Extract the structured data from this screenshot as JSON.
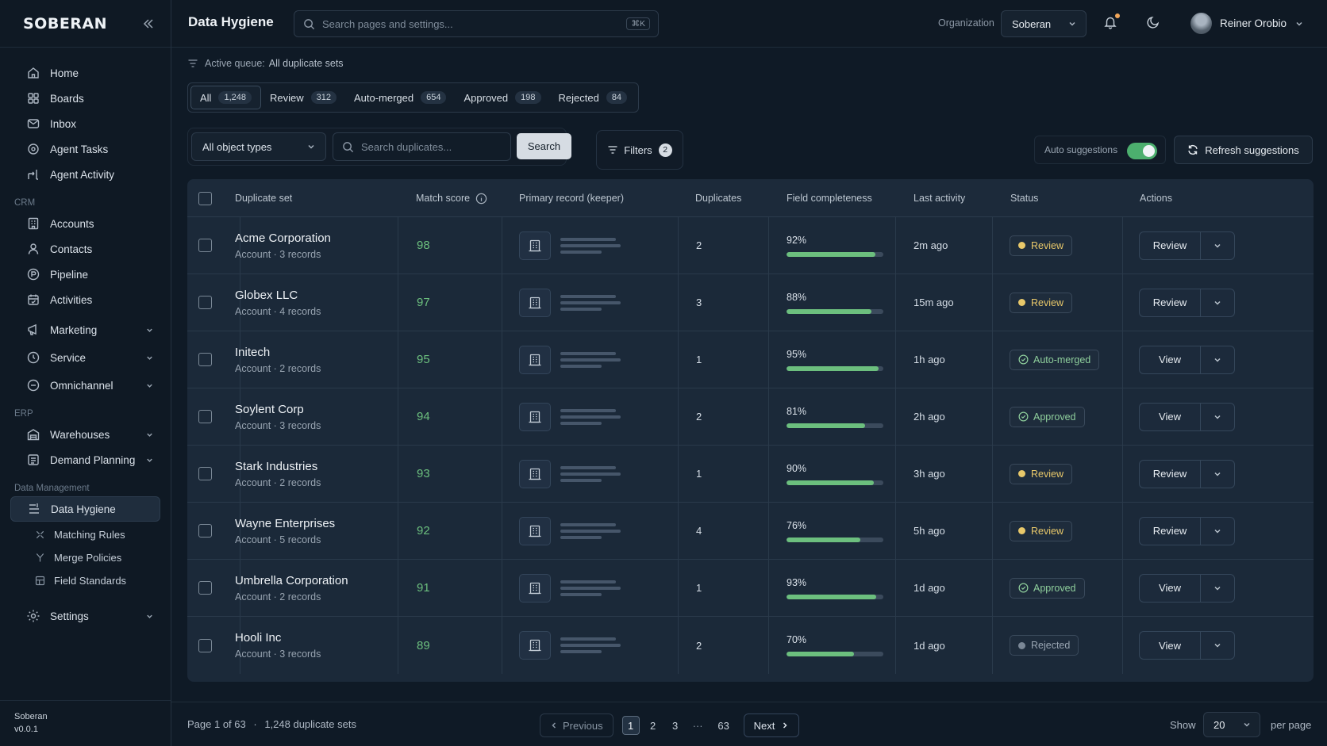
{
  "app": {
    "logo": "SOBERAN",
    "version_name": "Soberan",
    "version": "v0.0.1"
  },
  "header": {
    "title": "Data Hygiene",
    "search_placeholder": "Search pages and settings...",
    "shortcut": "⌘K",
    "org_label": "Organization",
    "org_value": "Soberan",
    "user_name": "Reiner Orobio"
  },
  "sidebar": {
    "items": [
      {
        "label": "Home",
        "icon": "home-icon"
      },
      {
        "label": "Boards",
        "icon": "boards-icon"
      },
      {
        "label": "Inbox",
        "icon": "inbox-icon"
      },
      {
        "label": "Agent Tasks",
        "icon": "agent-tasks-icon"
      },
      {
        "label": "Agent Activity",
        "icon": "agent-activity-icon"
      }
    ],
    "crm_label": "CRM",
    "crm_items": [
      {
        "label": "Accounts",
        "icon": "accounts-icon"
      },
      {
        "label": "Contacts",
        "icon": "contacts-icon"
      },
      {
        "label": "Pipeline",
        "icon": "pipeline-icon"
      },
      {
        "label": "Activities",
        "icon": "activities-icon"
      }
    ],
    "groups": [
      {
        "label": "Marketing",
        "icon": "marketing-icon"
      },
      {
        "label": "Service",
        "icon": "service-icon"
      },
      {
        "label": "Omnichannel",
        "icon": "omnichannel-icon"
      }
    ],
    "erp_label": "ERP",
    "erp_items": [
      {
        "label": "Warehouses",
        "icon": "warehouses-icon"
      },
      {
        "label": "Demand Planning",
        "icon": "demand-planning-icon"
      }
    ],
    "dm_label": "Data Management",
    "dm_active": "Data Hygiene",
    "dm_sub": [
      {
        "label": "Matching Rules",
        "icon": "matching-rules-icon"
      },
      {
        "label": "Merge Policies",
        "icon": "merge-policies-icon"
      },
      {
        "label": "Field Standards",
        "icon": "field-standards-icon"
      }
    ],
    "settings": "Settings"
  },
  "queue": {
    "label": "Active queue:",
    "value": "All duplicate sets"
  },
  "tabs": [
    {
      "label": "All",
      "count": "1,248"
    },
    {
      "label": "Review",
      "count": "312"
    },
    {
      "label": "Auto-merged",
      "count": "654"
    },
    {
      "label": "Approved",
      "count": "198"
    },
    {
      "label": "Rejected",
      "count": "84"
    }
  ],
  "toolbar": {
    "object_type": "All object types",
    "search_placeholder": "Search duplicates...",
    "search_label": "Search",
    "filters_label": "Filters",
    "filters_count": "2",
    "auto_label": "Auto suggestions",
    "auto_on": true,
    "refresh_label": "Refresh suggestions"
  },
  "table": {
    "headers": {
      "set": "Duplicate set",
      "score": "Match score",
      "primary": "Primary record (keeper)",
      "dups": "Duplicates",
      "complete": "Field completeness",
      "activity": "Last activity",
      "status": "Status",
      "actions": "Actions"
    },
    "rows": [
      {
        "name": "Acme Corporation",
        "sub": "Account · 3 records",
        "score": "98",
        "dups": "2",
        "pct": "92%",
        "fill": 0.92,
        "activity": "2m ago",
        "status": "Review",
        "status_type": "review",
        "action": "Review"
      },
      {
        "name": "Globex LLC",
        "sub": "Account · 4 records",
        "score": "97",
        "dups": "3",
        "pct": "88%",
        "fill": 0.88,
        "activity": "15m ago",
        "status": "Review",
        "status_type": "review",
        "action": "Review"
      },
      {
        "name": "Initech",
        "sub": "Account · 2 records",
        "score": "95",
        "dups": "1",
        "pct": "95%",
        "fill": 0.95,
        "activity": "1h ago",
        "status": "Auto-merged",
        "status_type": "automerged",
        "action": "View"
      },
      {
        "name": "Soylent Corp",
        "sub": "Account · 3 records",
        "score": "94",
        "dups": "2",
        "pct": "81%",
        "fill": 0.81,
        "activity": "2h ago",
        "status": "Approved",
        "status_type": "approved",
        "action": "View"
      },
      {
        "name": "Stark Industries",
        "sub": "Account · 2 records",
        "score": "93",
        "dups": "1",
        "pct": "90%",
        "fill": 0.9,
        "activity": "3h ago",
        "status": "Review",
        "status_type": "review",
        "action": "Review"
      },
      {
        "name": "Wayne Enterprises",
        "sub": "Account · 5 records",
        "score": "92",
        "dups": "4",
        "pct": "76%",
        "fill": 0.76,
        "activity": "5h ago",
        "status": "Review",
        "status_type": "review",
        "action": "Review"
      },
      {
        "name": "Umbrella Corporation",
        "sub": "Account · 2 records",
        "score": "91",
        "dups": "1",
        "pct": "93%",
        "fill": 0.93,
        "activity": "1d ago",
        "status": "Approved",
        "status_type": "approved",
        "action": "View"
      },
      {
        "name": "Hooli Inc",
        "sub": "Account · 3 records",
        "score": "89",
        "dups": "2",
        "pct": "70%",
        "fill": 0.7,
        "activity": "1d ago",
        "status": "Rejected",
        "status_type": "rejected",
        "action": "View"
      }
    ]
  },
  "footer": {
    "page_info": "Page 1 of 63",
    "separator": "·",
    "total": "1,248 duplicate sets",
    "prev": "Previous",
    "next": "Next",
    "pages": [
      "1",
      "2",
      "3"
    ],
    "ellipsis": "···",
    "last_page": "63",
    "show_label": "Show",
    "per_value": "20",
    "per_label": "per page"
  },
  "colors": {
    "accent_green": "#6cbf7e",
    "review_yellow": "#e8c86a",
    "background": "#0f1a26"
  }
}
